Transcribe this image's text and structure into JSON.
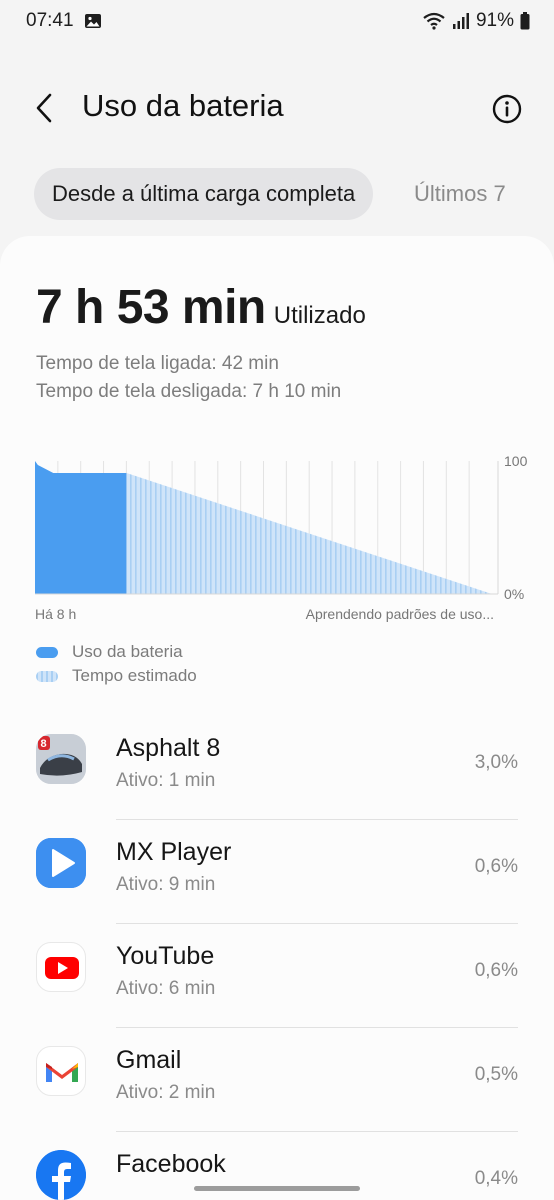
{
  "status_bar": {
    "time": "07:41",
    "battery": "91%"
  },
  "header": {
    "title": "Uso da bateria"
  },
  "tabs": [
    {
      "label": "Desde a última carga completa"
    },
    {
      "label": "Últimos 7"
    }
  ],
  "summary": {
    "usage_time": "7 h 53 min",
    "usage_suffix": "Utilizado",
    "screen_on": "Tempo de tela ligada: 42 min",
    "screen_off": "Tempo de tela desligada: 7 h 10 min"
  },
  "chart_data": {
    "type": "area",
    "title": "",
    "xlabel": "",
    "ylabel": "",
    "ylim": [
      0,
      100
    ],
    "y_ticks": [
      "100",
      "0%"
    ],
    "x_start_label": "Há 8 h",
    "x_end_label": "Aprendendo padrões de uso...",
    "series": [
      {
        "name": "Uso da bateria",
        "color": "#4a9df0",
        "x": [
          0,
          0.25,
          1.6,
          8
        ],
        "y": [
          100,
          97,
          91,
          91
        ]
      },
      {
        "name": "Tempo estimado",
        "color": "#bcdaf7",
        "x": [
          8,
          40
        ],
        "y": [
          91,
          0
        ]
      }
    ],
    "grid": true,
    "legend": "bottom-left"
  },
  "apps": [
    {
      "name": "Asphalt 8",
      "active": "Ativo: 1 min",
      "pct": "3,0%",
      "icon": "asphalt-8-icon"
    },
    {
      "name": "MX Player",
      "active": "Ativo: 9 min",
      "pct": "0,6%",
      "icon": "mx-player-icon"
    },
    {
      "name": "YouTube",
      "active": "Ativo: 6 min",
      "pct": "0,6%",
      "icon": "youtube-icon"
    },
    {
      "name": "Gmail",
      "active": "Ativo: 2 min",
      "pct": "0,5%",
      "icon": "gmail-icon"
    },
    {
      "name": "Facebook",
      "active": "",
      "pct": "0,4%",
      "icon": "facebook-icon"
    }
  ],
  "colors": {
    "accent": "#4a9df0",
    "estimated": "#bcdaf7",
    "background": "#f4f4f4",
    "card": "#fcfcfc"
  }
}
